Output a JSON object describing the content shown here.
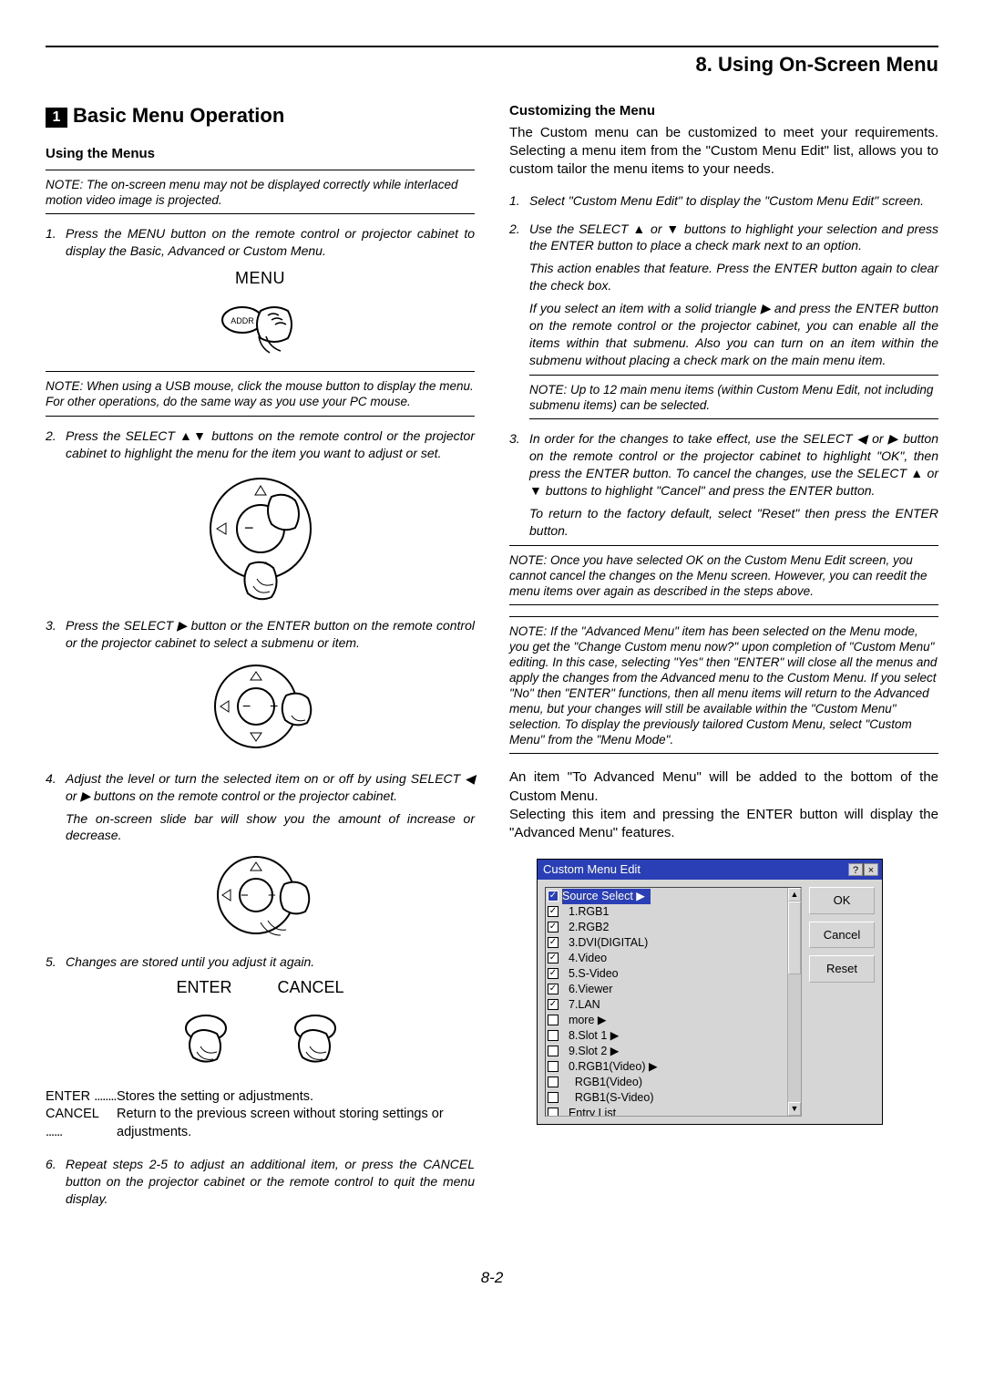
{
  "chapter": "8. Using On-Screen Menu",
  "section_num": "1",
  "section_title": "Basic Menu Operation",
  "left": {
    "sub": "Using the Menus",
    "note1": "NOTE: The on-screen menu may not be displayed correctly while interlaced motion video image is projected.",
    "s1": "Press the MENU button on the remote control or projector cabinet to display the Basic, Advanced or Custom Menu.",
    "menu_lbl": "MENU",
    "addr_lbl": "ADDR",
    "note2": "NOTE: When using a USB mouse, click the mouse button to display the menu. For other operations, do the same way as you use your PC mouse.",
    "s2": "Press the SELECT ▲▼ buttons on the remote control or the projector cabinet to highlight the menu for the item you want to adjust or set.",
    "s3": "Press the SELECT ▶ button or the ENTER button on the remote control or the projector cabinet to select a submenu or item.",
    "s4": "Adjust the level or turn the selected item on or off by using SELECT ◀ or ▶ buttons on the remote control or the projector cabinet.",
    "s4b": "The on-screen slide bar will show you the amount of increase or decrease.",
    "s5": "Changes are stored until you adjust it again.",
    "enter_lbl": "ENTER",
    "cancel_lbl": "CANCEL",
    "enter_k": "ENTER",
    "enter_dots": "........",
    "enter_v": "Stores the setting or adjustments.",
    "cancel_k": "CANCEL",
    "cancel_dots": "......",
    "cancel_v": "Return to the previous screen without storing settings or adjustments.",
    "s6": "Repeat steps 2-5 to adjust an additional item, or press the CANCEL button on the projector cabinet or the remote control to quit the menu display."
  },
  "right": {
    "sub": "Customizing the Menu",
    "intro": "The Custom menu can be customized to meet your requirements. Selecting a menu item from the \"Custom Menu Edit\" list, allows you to custom tailor the menu items to your needs.",
    "s1": "Select \"Custom Menu Edit\" to display the \"Custom Menu Edit\" screen.",
    "s2": "Use the SELECT ▲ or ▼ buttons to highlight your selection and press the ENTER button to place a check mark next to an option.",
    "s2b": "This action enables that feature. Press the ENTER button again to clear the check box.",
    "s2c": "If you select an item with a solid triangle ▶ and press the ENTER button on the remote control or the projector cabinet, you can enable all the items within that submenu. Also you can turn on an item within the submenu without placing a check mark on the main menu item.",
    "note1": "NOTE: Up to 12 main menu items (within Custom Menu Edit, not including submenu items) can be selected.",
    "s3": "In order for the changes to take effect, use the SELECT ◀ or ▶ button on the remote control or the projector cabinet to highlight \"OK\", then press the ENTER button. To cancel the changes, use the SELECT ▲ or ▼ buttons to highlight \"Cancel\" and press the ENTER button.",
    "s3b": "To return to the factory default, select \"Reset\" then press the ENTER button.",
    "note2": "NOTE: Once you have selected OK on the Custom Menu Edit screen, you cannot cancel the changes on the Menu screen. However, you can reedit the menu items over again as described in the steps above.",
    "note3": "NOTE: If the \"Advanced Menu\" item has been selected on the Menu mode, you get the \"Change Custom menu now?\" upon completion of \"Custom Menu\" editing. In this case, selecting \"Yes\" then \"ENTER\" will close all the menus and apply the changes from the Advanced menu to the Custom Menu. If you select \"No\" then \"ENTER\" functions, then all menu items will return to the Advanced menu, but your changes will still be available within the \"Custom Menu\" selection. To display the previously tailored Custom Menu, select \"Custom Menu\" from the \"Menu Mode\".",
    "post1": "An item \"To Advanced Menu\" will be added to the bottom of the Custom Menu.",
    "post2": "Selecting this item and pressing the ENTER button will display the \"Advanced Menu\" features."
  },
  "cme": {
    "title": "Custom Menu Edit",
    "ok": "OK",
    "cancel": "Cancel",
    "reset": "Reset",
    "items": [
      {
        "c": true,
        "t": "Source Select ▶",
        "hi": true
      },
      {
        "c": true,
        "t": "1.RGB1"
      },
      {
        "c": true,
        "t": "2.RGB2"
      },
      {
        "c": true,
        "t": "3.DVI(DIGITAL)"
      },
      {
        "c": true,
        "t": "4.Video"
      },
      {
        "c": true,
        "t": "5.S-Video"
      },
      {
        "c": true,
        "t": "6.Viewer"
      },
      {
        "c": true,
        "t": "7.LAN"
      },
      {
        "c": false,
        "t": "more ▶"
      },
      {
        "c": false,
        "t": "8.Slot 1 ▶"
      },
      {
        "c": false,
        "t": "9.Slot 2 ▶"
      },
      {
        "c": false,
        "t": "0.RGB1(Video) ▶"
      },
      {
        "c": false,
        "t": "  RGB1(Video)"
      },
      {
        "c": false,
        "t": "  RGB1(S-Video)"
      },
      {
        "c": false,
        "t": "Entry List"
      }
    ]
  },
  "page": "8-2"
}
